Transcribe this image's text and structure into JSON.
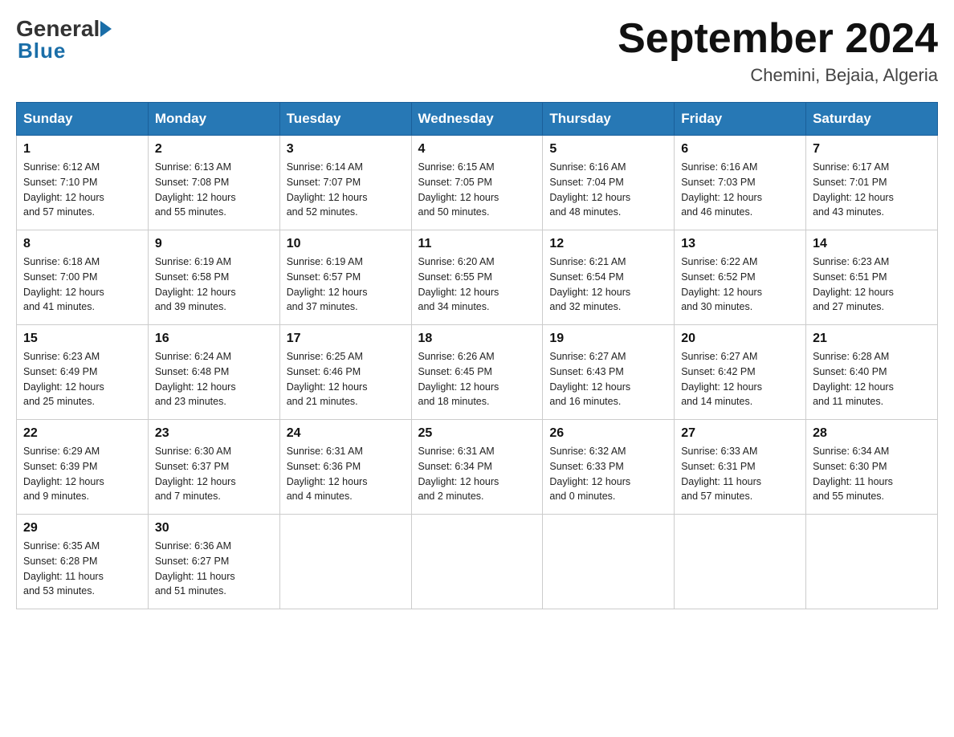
{
  "header": {
    "logo_general": "General",
    "logo_blue": "Blue",
    "month_year": "September 2024",
    "location": "Chemini, Bejaia, Algeria"
  },
  "columns": [
    "Sunday",
    "Monday",
    "Tuesday",
    "Wednesday",
    "Thursday",
    "Friday",
    "Saturday"
  ],
  "weeks": [
    [
      {
        "day": "1",
        "info": "Sunrise: 6:12 AM\nSunset: 7:10 PM\nDaylight: 12 hours\nand 57 minutes."
      },
      {
        "day": "2",
        "info": "Sunrise: 6:13 AM\nSunset: 7:08 PM\nDaylight: 12 hours\nand 55 minutes."
      },
      {
        "day": "3",
        "info": "Sunrise: 6:14 AM\nSunset: 7:07 PM\nDaylight: 12 hours\nand 52 minutes."
      },
      {
        "day": "4",
        "info": "Sunrise: 6:15 AM\nSunset: 7:05 PM\nDaylight: 12 hours\nand 50 minutes."
      },
      {
        "day": "5",
        "info": "Sunrise: 6:16 AM\nSunset: 7:04 PM\nDaylight: 12 hours\nand 48 minutes."
      },
      {
        "day": "6",
        "info": "Sunrise: 6:16 AM\nSunset: 7:03 PM\nDaylight: 12 hours\nand 46 minutes."
      },
      {
        "day": "7",
        "info": "Sunrise: 6:17 AM\nSunset: 7:01 PM\nDaylight: 12 hours\nand 43 minutes."
      }
    ],
    [
      {
        "day": "8",
        "info": "Sunrise: 6:18 AM\nSunset: 7:00 PM\nDaylight: 12 hours\nand 41 minutes."
      },
      {
        "day": "9",
        "info": "Sunrise: 6:19 AM\nSunset: 6:58 PM\nDaylight: 12 hours\nand 39 minutes."
      },
      {
        "day": "10",
        "info": "Sunrise: 6:19 AM\nSunset: 6:57 PM\nDaylight: 12 hours\nand 37 minutes."
      },
      {
        "day": "11",
        "info": "Sunrise: 6:20 AM\nSunset: 6:55 PM\nDaylight: 12 hours\nand 34 minutes."
      },
      {
        "day": "12",
        "info": "Sunrise: 6:21 AM\nSunset: 6:54 PM\nDaylight: 12 hours\nand 32 minutes."
      },
      {
        "day": "13",
        "info": "Sunrise: 6:22 AM\nSunset: 6:52 PM\nDaylight: 12 hours\nand 30 minutes."
      },
      {
        "day": "14",
        "info": "Sunrise: 6:23 AM\nSunset: 6:51 PM\nDaylight: 12 hours\nand 27 minutes."
      }
    ],
    [
      {
        "day": "15",
        "info": "Sunrise: 6:23 AM\nSunset: 6:49 PM\nDaylight: 12 hours\nand 25 minutes."
      },
      {
        "day": "16",
        "info": "Sunrise: 6:24 AM\nSunset: 6:48 PM\nDaylight: 12 hours\nand 23 minutes."
      },
      {
        "day": "17",
        "info": "Sunrise: 6:25 AM\nSunset: 6:46 PM\nDaylight: 12 hours\nand 21 minutes."
      },
      {
        "day": "18",
        "info": "Sunrise: 6:26 AM\nSunset: 6:45 PM\nDaylight: 12 hours\nand 18 minutes."
      },
      {
        "day": "19",
        "info": "Sunrise: 6:27 AM\nSunset: 6:43 PM\nDaylight: 12 hours\nand 16 minutes."
      },
      {
        "day": "20",
        "info": "Sunrise: 6:27 AM\nSunset: 6:42 PM\nDaylight: 12 hours\nand 14 minutes."
      },
      {
        "day": "21",
        "info": "Sunrise: 6:28 AM\nSunset: 6:40 PM\nDaylight: 12 hours\nand 11 minutes."
      }
    ],
    [
      {
        "day": "22",
        "info": "Sunrise: 6:29 AM\nSunset: 6:39 PM\nDaylight: 12 hours\nand 9 minutes."
      },
      {
        "day": "23",
        "info": "Sunrise: 6:30 AM\nSunset: 6:37 PM\nDaylight: 12 hours\nand 7 minutes."
      },
      {
        "day": "24",
        "info": "Sunrise: 6:31 AM\nSunset: 6:36 PM\nDaylight: 12 hours\nand 4 minutes."
      },
      {
        "day": "25",
        "info": "Sunrise: 6:31 AM\nSunset: 6:34 PM\nDaylight: 12 hours\nand 2 minutes."
      },
      {
        "day": "26",
        "info": "Sunrise: 6:32 AM\nSunset: 6:33 PM\nDaylight: 12 hours\nand 0 minutes."
      },
      {
        "day": "27",
        "info": "Sunrise: 6:33 AM\nSunset: 6:31 PM\nDaylight: 11 hours\nand 57 minutes."
      },
      {
        "day": "28",
        "info": "Sunrise: 6:34 AM\nSunset: 6:30 PM\nDaylight: 11 hours\nand 55 minutes."
      }
    ],
    [
      {
        "day": "29",
        "info": "Sunrise: 6:35 AM\nSunset: 6:28 PM\nDaylight: 11 hours\nand 53 minutes."
      },
      {
        "day": "30",
        "info": "Sunrise: 6:36 AM\nSunset: 6:27 PM\nDaylight: 11 hours\nand 51 minutes."
      },
      {
        "day": "",
        "info": ""
      },
      {
        "day": "",
        "info": ""
      },
      {
        "day": "",
        "info": ""
      },
      {
        "day": "",
        "info": ""
      },
      {
        "day": "",
        "info": ""
      }
    ]
  ]
}
